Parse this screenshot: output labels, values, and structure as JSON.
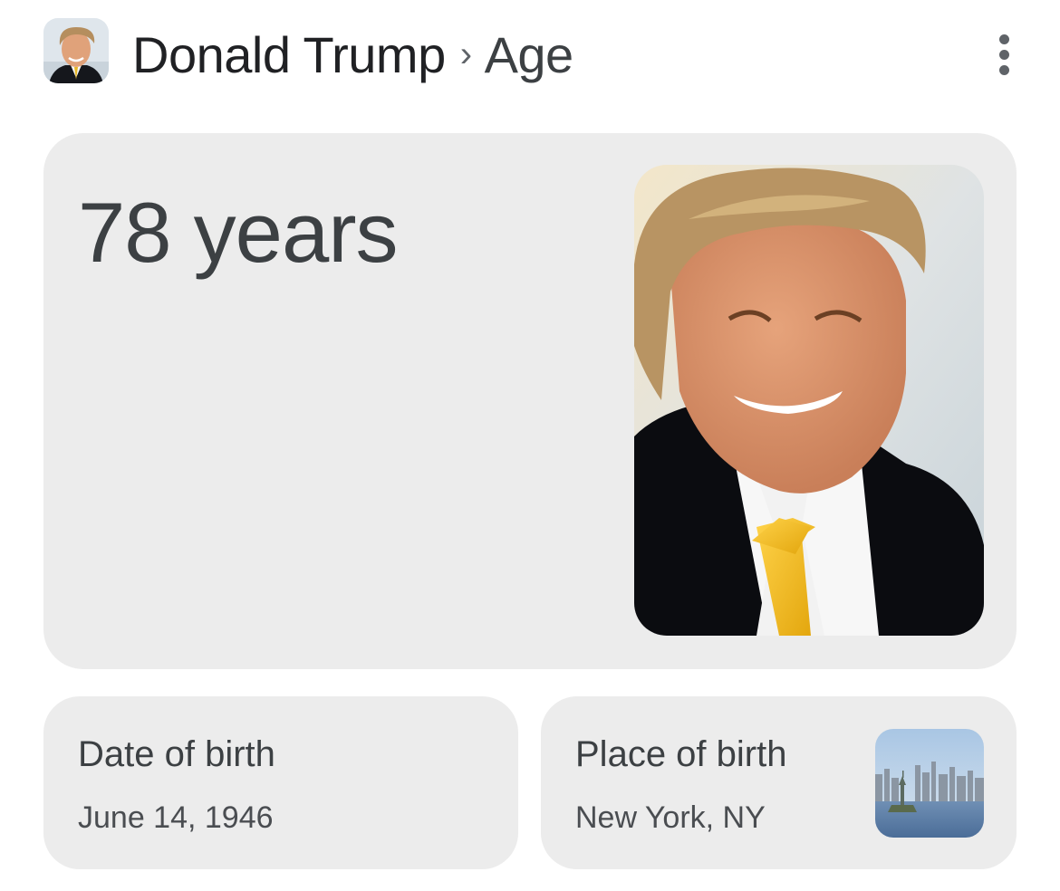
{
  "header": {
    "avatar_icon": "person-photo-icon",
    "entity_name": "Donald Trump",
    "separator": "›",
    "attribute": "Age",
    "more_icon": "more-vert-icon"
  },
  "age_card": {
    "value": "78 years",
    "image": "portrait-photo"
  },
  "date_of_birth": {
    "label": "Date of birth",
    "value": "June 14, 1946"
  },
  "place_of_birth": {
    "label": "Place of birth",
    "value": "New York, NY",
    "image": "city-skyline-photo"
  },
  "colors": {
    "card_background": "#ececec",
    "primary_text": "#202124",
    "secondary_text": "#5f6368"
  }
}
